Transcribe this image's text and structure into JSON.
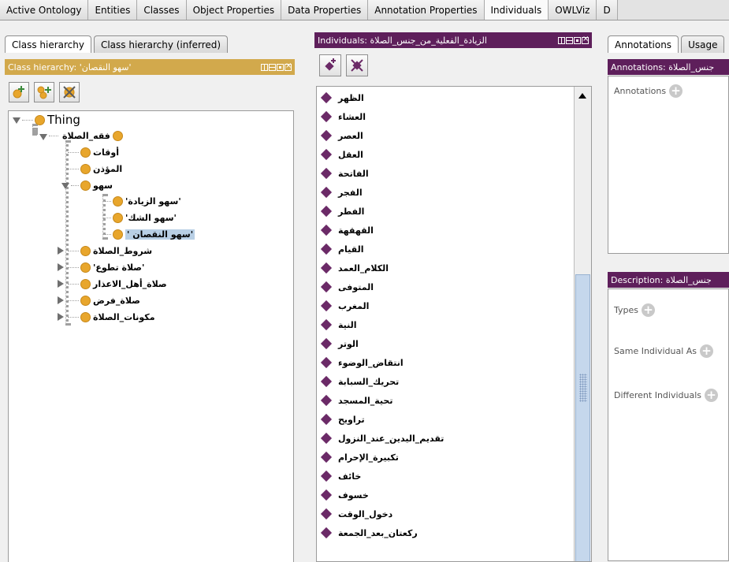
{
  "tabs": [
    "Active Ontology",
    "Entities",
    "Classes",
    "Object Properties",
    "Data Properties",
    "Annotation Properties",
    "Individuals",
    "OWLViz",
    "D"
  ],
  "active_tab_index": 6,
  "left": {
    "subtabs": [
      "Class hierarchy",
      "Class hierarchy (inferred)"
    ],
    "view_title": "Class hierarchy: 'سهو النقصان'",
    "tree": {
      "root": "Thing",
      "fiqh": "فقه_الصلاة",
      "awqat": "أوقات",
      "muadhin": "المؤذن",
      "sahw": "سهو",
      "sahw_ziyada": "'سهو الزيادة'",
      "sahw_shak": "'سهو الشك'",
      "sahw_nuqsan": "' سهو النقصان'",
      "shurut": "شروط_الصلاة",
      "tatawwu": "'صلاة تطوع'",
      "ahl_alaadhar": "صلاة_أهل_الاعذار",
      "fard": "صلاة_فرض",
      "mukawwinat": "مكونات_الصلاة"
    }
  },
  "middle": {
    "view_title": "Individuals: الزيادة_الفعلية_من_جنس_الصلاة",
    "individuals": [
      "الظهر",
      "العشاء",
      "العصر",
      "العقل",
      "الفاتحة",
      "الفجر",
      "الفطر",
      "القهقهة",
      "القيام",
      "الكلام_العمد",
      "المتوفى",
      "المغرب",
      "النية",
      "الوتر",
      "انتقاض_الوضوء",
      "تحريك_السبابة",
      "تحية_المسجد",
      "تراويح",
      "تقديم_اليدين_عند_النزول",
      "تكبيرة_الإحرام",
      "خائف",
      "خسوف",
      "دخول_الوقت",
      "ركعتان_بعد_الجمعة"
    ]
  },
  "right": {
    "subtabs": [
      "Annotations",
      "Usage"
    ],
    "annotations_title": "Annotations: جنس_الصلاة",
    "annotations_label": "Annotations",
    "description_title": "Description: جنس_الصلاة",
    "types_label": "Types",
    "same_label": "Same Individual As",
    "different_label": "Different Individuals"
  },
  "colors": {
    "class_header": "#d2a94c",
    "individual_header": "#5e1f5b",
    "class_circle": "#e8a62c",
    "individual_diamond": "#6b2a67",
    "selection": "#b8cfe5"
  }
}
